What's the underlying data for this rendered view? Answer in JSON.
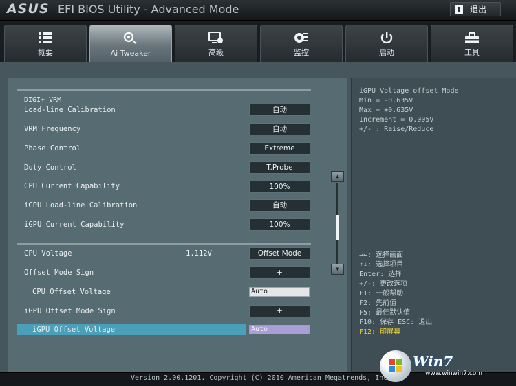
{
  "header": {
    "brand": "ASUS",
    "title": "EFI BIOS Utility - Advanced Mode",
    "exit_label": "退出"
  },
  "tabs": [
    {
      "label": "概要",
      "icon": "list-icon"
    },
    {
      "label": "Ai Tweaker",
      "icon": "ai-tweaker-icon"
    },
    {
      "label": "高级",
      "icon": "advanced-icon"
    },
    {
      "label": "监控",
      "icon": "monitor-icon"
    },
    {
      "label": "启动",
      "icon": "power-icon"
    },
    {
      "label": "工具",
      "icon": "tool-icon"
    }
  ],
  "active_tab": "Ai Tweaker",
  "main": {
    "section_title": "DIGI+ VRM",
    "rows": [
      {
        "label": "Load-line Calibration",
        "button": "自动"
      },
      {
        "label": "VRM Frequency",
        "button": "自动"
      },
      {
        "label": "Phase Control",
        "button": "Extreme"
      },
      {
        "label": "Duty Control",
        "button": "T.Probe"
      },
      {
        "label": "CPU Current Capability",
        "button": "100%"
      },
      {
        "label": "iGPU Load-line Calibration",
        "button": "自动"
      },
      {
        "label": "iGPU Current Capability",
        "button": "100%"
      },
      {
        "label": "CPU Voltage",
        "value": "1.112V",
        "button": "Offset Mode"
      },
      {
        "label": "Offset Mode Sign",
        "button": "+"
      },
      {
        "label": "CPU Offset Voltage",
        "input": "Auto"
      },
      {
        "label": "iGPU Offset Mode Sign",
        "button": "+"
      },
      {
        "label": "iGPU Offset Voltage",
        "input": "Auto"
      }
    ],
    "selected_item": "iGPU Offset Voltage"
  },
  "scrollbar": {
    "up_icon": "scroll-up-arrow-icon",
    "down_icon": "scroll-down-arrow-icon"
  },
  "help": {
    "title": "iGPU Voltage offset Mode",
    "lines": [
      "Min = -0.635V",
      "Max = +0.635V",
      "Increment = 0.005V",
      "+/- : Raise/Reduce"
    ]
  },
  "keys": [
    "→←: 选择画面",
    "↑↓: 选择项目",
    "Enter: 选择",
    "+/-: 更改选项",
    "F1: 一般帮助",
    "F2: 先前值",
    "F5: 最佳默认值",
    "F10: 保存  ESC: 退出",
    "F12: 印屏幕"
  ],
  "footer": {
    "version": "Version 2.00.1201. Copyright (C) 2010 American Megatrends, Inc."
  },
  "watermark": {
    "brand": "Win7",
    "url": "www.winwin7.com"
  },
  "colors": {
    "selection_bar": "#4a9fb9",
    "selected_input": "#a99fd6",
    "key_highlight": "#f0d234"
  }
}
